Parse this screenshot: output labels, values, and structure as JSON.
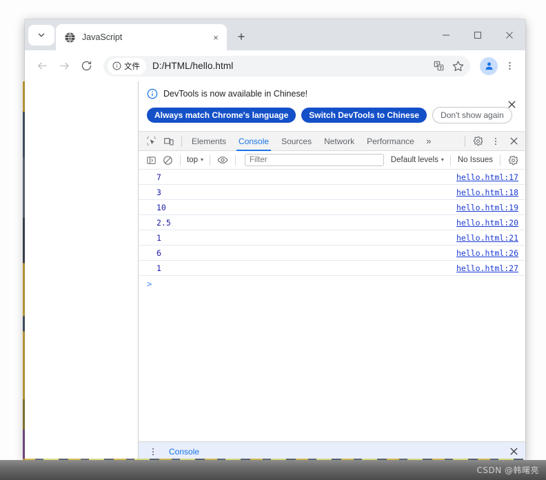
{
  "browser": {
    "tab": {
      "title": "JavaScript",
      "favicon": "globe-icon",
      "close": "×"
    },
    "tab_search": "chevron-down-icon",
    "new_tab": "+",
    "window_controls": {
      "minimize": "—",
      "maximize": "□",
      "close": "×"
    },
    "nav": {
      "back": "←",
      "forward": "→",
      "reload": "↻"
    },
    "omnibox": {
      "chip_icon": "info-circle-icon",
      "chip_label": "文件",
      "url": "D:/HTML/hello.html",
      "translate_icon": "translate-icon",
      "bookmark_icon": "star-icon",
      "profile_icon": "person-icon",
      "menu_icon": "kebab-menu-icon"
    }
  },
  "devtools": {
    "notification": {
      "icon": "info-circle-icon",
      "message": "DevTools is now available in Chinese!",
      "primary_button_1": "Always match Chrome's language",
      "primary_button_2": "Switch DevTools to Chinese",
      "ghost_button": "Don't show again",
      "close": "×"
    },
    "tabs": [
      {
        "label": "Elements",
        "active": false
      },
      {
        "label": "Console",
        "active": true
      },
      {
        "label": "Sources",
        "active": false
      },
      {
        "label": "Network",
        "active": false
      },
      {
        "label": "Performance",
        "active": false
      }
    ],
    "tab_overflow": "»",
    "left_icons": {
      "inspect": "inspect-element-icon",
      "device": "device-toolbar-icon"
    },
    "right_icons": {
      "settings": "gear-icon",
      "more": "kebab-menu-icon",
      "close": "×"
    },
    "console_toolbar": {
      "sidebar_icon": "console-sidebar-icon",
      "clear_icon": "clear-console-icon",
      "context": "top",
      "eye_icon": "live-expression-eye-icon",
      "filter_placeholder": "Filter",
      "levels": "Default levels",
      "issues": "No Issues",
      "settings_icon": "gear-icon",
      "caret": "▾"
    },
    "console_rows": [
      {
        "value": "7",
        "source": "hello.html:17"
      },
      {
        "value": "3",
        "source": "hello.html:18"
      },
      {
        "value": "10",
        "source": "hello.html:19"
      },
      {
        "value": "2.5",
        "source": "hello.html:20"
      },
      {
        "value": "1",
        "source": "hello.html:21"
      },
      {
        "value": "6",
        "source": "hello.html:26"
      },
      {
        "value": "1",
        "source": "hello.html:27"
      }
    ],
    "prompt_symbol": ">",
    "drawer": {
      "menu_icon": "kebab-menu-icon",
      "tab_label": "Console",
      "close": "×"
    }
  },
  "watermark": "CSDN @韩曙亮",
  "colors": {
    "accent_blue": "#1a73e8",
    "button_blue": "#1450c8",
    "console_value": "#1a1aa6",
    "console_link": "#1a3ad1",
    "tabstrip_bg": "#dee1e6"
  }
}
